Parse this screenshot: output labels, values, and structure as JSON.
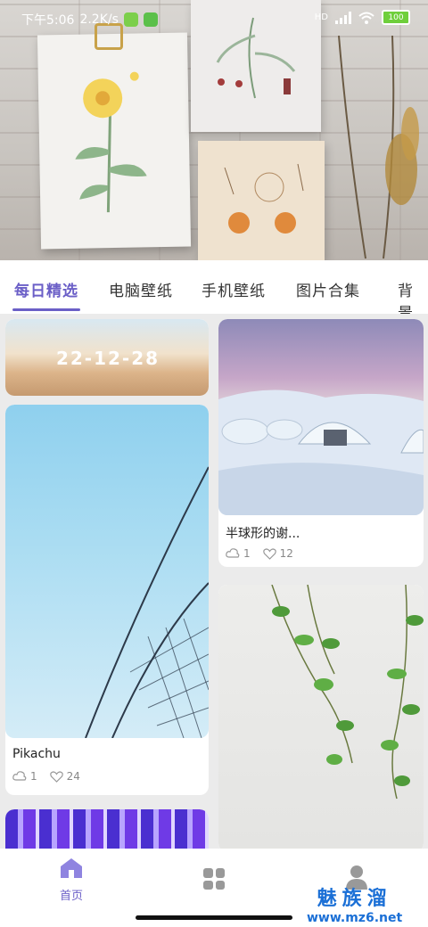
{
  "status": {
    "time": "下午5:06",
    "speed": "2.2K/s",
    "network": "HD",
    "battery": "100"
  },
  "tabs": [
    {
      "label": "每日精选",
      "active": true
    },
    {
      "label": "电脑壁纸",
      "active": false
    },
    {
      "label": "手机壁纸",
      "active": false
    },
    {
      "label": "图片合集",
      "active": false
    },
    {
      "label": "背景",
      "active": false
    }
  ],
  "cards": {
    "daily": {
      "date": "22-12-28"
    },
    "pikachu": {
      "title": "Pikachu",
      "downloads": "1",
      "likes": "24"
    },
    "dome": {
      "title": "半球形的谢...",
      "downloads": "1",
      "likes": "12"
    }
  },
  "bottom_nav": {
    "home_label": "首页",
    "home_icon": "home-icon",
    "category_icon": "grid-icon",
    "profile_icon": "user-icon"
  },
  "watermark": {
    "cn": "魅族溜",
    "url": "www.mz6.net"
  },
  "colors": {
    "accent": "#6b5fc7"
  }
}
